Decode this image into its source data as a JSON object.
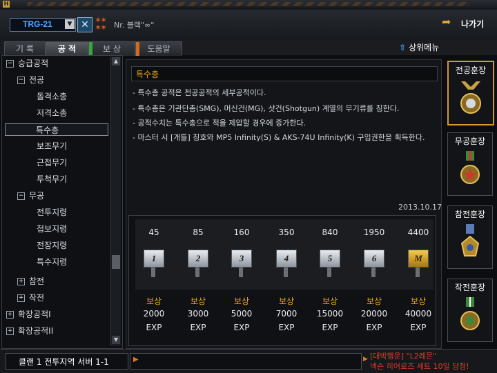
{
  "header": {
    "clan_select_value": "TRG-21",
    "user_name": "Nr. 블랙\"∞\"",
    "exit_label": "나가기"
  },
  "tabs": [
    {
      "label": "기 록",
      "active": false
    },
    {
      "label": "공 적",
      "active": true
    },
    {
      "label": "보 상",
      "active": false,
      "mark_color": "#3aa63a"
    },
    {
      "label": "도움말",
      "active": false,
      "mark_color": "#d66a1a"
    }
  ],
  "up_menu_label": "상위메뉴",
  "tree": [
    {
      "label": "승급공적",
      "box": "−",
      "level": 0
    },
    {
      "label": "전공",
      "box": "−",
      "level": 1
    },
    {
      "label": "돌격소총",
      "level": 2
    },
    {
      "label": "저격소총",
      "level": 2
    },
    {
      "label": "특수총",
      "level": 2,
      "selected": true
    },
    {
      "label": "보조무기",
      "level": 2
    },
    {
      "label": "근접무기",
      "level": 2
    },
    {
      "label": "투척무기",
      "level": 2
    },
    {
      "label": "무공",
      "box": "−",
      "level": 1
    },
    {
      "label": "전투지령",
      "level": 2
    },
    {
      "label": "첩보지령",
      "level": 2
    },
    {
      "label": "전장지령",
      "level": 2
    },
    {
      "label": "특수지령",
      "level": 2
    },
    {
      "label": "참전",
      "box": "+",
      "level": 1
    },
    {
      "label": "작전",
      "box": "+",
      "level": 1
    },
    {
      "label": "확장공적I",
      "box": "+",
      "level": 0
    },
    {
      "label": "확장공적II",
      "box": "+",
      "level": 0
    }
  ],
  "detail": {
    "title": "특수총",
    "lines": [
      "- 특수총 공적은 전공공적의 세부공적이다.",
      "- 특수총은 기관단총(SMG), 머신건(MG), 샷건(Shotgun) 계열의 무기류를 칭한다.",
      "- 공적수치는 특수총으로 적을 제압할 경우에 증가한다.",
      "- 마스터 시 [개틀] 칭호와 MP5 Infinity(S) & AKS-74U Infinity(K) 구입권한을 획득한다."
    ],
    "date": "2013.10.17"
  },
  "progress": {
    "levels": [
      {
        "threshold": "45",
        "badge": "1",
        "reward_label": "보상",
        "reward_value": "2000",
        "reward_unit": "EXP"
      },
      {
        "threshold": "85",
        "badge": "2",
        "reward_label": "보상",
        "reward_value": "3000",
        "reward_unit": "EXP"
      },
      {
        "threshold": "160",
        "badge": "3",
        "reward_label": "보상",
        "reward_value": "5000",
        "reward_unit": "EXP"
      },
      {
        "threshold": "350",
        "badge": "4",
        "reward_label": "보상",
        "reward_value": "7000",
        "reward_unit": "EXP"
      },
      {
        "threshold": "840",
        "badge": "5",
        "reward_label": "보상",
        "reward_value": "15000",
        "reward_unit": "EXP"
      },
      {
        "threshold": "1950",
        "badge": "6",
        "reward_label": "보상",
        "reward_value": "20000",
        "reward_unit": "EXP"
      },
      {
        "threshold": "4400",
        "badge": "M",
        "reward_label": "보상",
        "reward_value": "40000",
        "reward_unit": "EXP"
      }
    ]
  },
  "medals": [
    {
      "label": "전공훈장",
      "active": true,
      "color": "#c9a040"
    },
    {
      "label": "무공훈장",
      "active": false,
      "color": "#c9a040"
    },
    {
      "label": "참전훈장",
      "active": false,
      "color": "#c9a040"
    },
    {
      "label": "작전훈장",
      "active": false,
      "color": "#c9a040"
    }
  ],
  "bottom": {
    "server_text": "클랜 1 전투지역 서버 1-1",
    "notice_line1": "[대박행운] \"L2레몬\"",
    "notice_line2": "넥슨 히어로즈 세트 10일 당첨!"
  },
  "icons": {
    "clan_dropdown": "chevron-down-icon",
    "clan_mark": "x-emblem-icon",
    "rank": "rank-stars-icon",
    "exit": "exit-door-icon",
    "up_menu": "up-arrow-icon"
  }
}
